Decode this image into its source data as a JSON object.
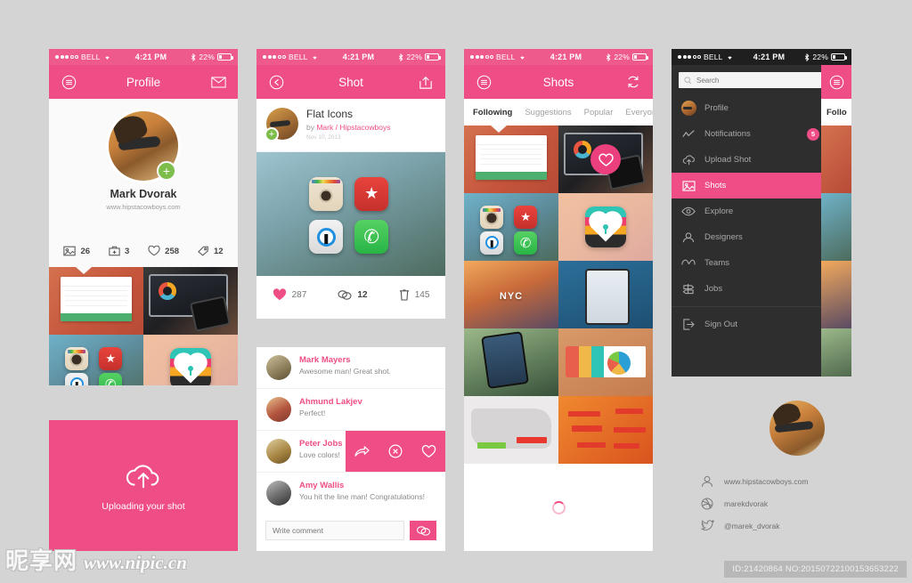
{
  "status_bar": {
    "carrier": "BELL",
    "time": "4:21 PM",
    "battery": "22%"
  },
  "screen_profile": {
    "nav": {
      "menu_icon": "hamburger-circle-icon",
      "title": "Profile",
      "right_icon": "mail-icon"
    },
    "user": {
      "name": "Mark Dvorak",
      "url": "www.hipstacowboys.com",
      "add_label": "+"
    },
    "stats": [
      {
        "icon": "image-icon",
        "value": "26"
      },
      {
        "icon": "bucket-icon",
        "value": "3"
      },
      {
        "icon": "heart-icon",
        "value": "258"
      },
      {
        "icon": "tag-icon",
        "value": "12"
      }
    ],
    "thumbnails": [
      "invoice-app-shot",
      "desk-dashboard-shot",
      "flat-app-icons-shot",
      "lock-heart-icon-shot"
    ]
  },
  "upload_card": {
    "icon": "cloud-upload-icon",
    "caption": "Uploading your shot"
  },
  "screen_shot": {
    "nav": {
      "back_icon": "back-arrow-circle-icon",
      "title": "Shot",
      "right_icon": "share-icon"
    },
    "post": {
      "title": "Flat Icons",
      "byline_prefix": "by ",
      "author": "Mark / Hipstacowboys",
      "date": "Nov 10, 2013",
      "add_label": "+"
    },
    "stats": [
      {
        "icon": "heart-filled-icon",
        "value": "287"
      },
      {
        "icon": "comment-icon",
        "value": "12"
      },
      {
        "icon": "bucket-outline-icon",
        "value": "145"
      }
    ],
    "comments": [
      {
        "name": "Mark Mayers",
        "text": "Awesome man! Great shot.",
        "swiped": false
      },
      {
        "name": "Ahmund Lakjev",
        "text": "Perfect!",
        "swiped": false
      },
      {
        "name": "Peter Jobs",
        "text": "Love colors!",
        "swiped": true
      },
      {
        "name": "Amy Wallis",
        "text": "You hit the line man! Congratulations!",
        "swiped": false
      }
    ],
    "swipe_actions": [
      "share-arrow-icon",
      "delete-circle-icon",
      "heart-outline-icon"
    ],
    "composer": {
      "placeholder": "Write comment",
      "send_icon": "comment-send-icon"
    }
  },
  "screen_shots": {
    "nav": {
      "menu_icon": "hamburger-circle-icon",
      "title": "Shots",
      "right_icon": "refresh-icon"
    },
    "tabs": [
      {
        "label": "Following",
        "active": true
      },
      {
        "label": "Suggestions",
        "active": false
      },
      {
        "label": "Popular",
        "active": false
      },
      {
        "label": "Everyone",
        "active": false
      }
    ],
    "grid": [
      "invoice-app-shot",
      "desk-dashboard-liked-shot",
      "flat-app-icons-shot",
      "lock-heart-icon-shot",
      "nyc-photo-shot",
      "mobile-ui-shot",
      "hand-phone-shot",
      "chart-dashboard-shot",
      "world-map-light-shot",
      "world-map-orange-shot"
    ],
    "loading_icon": "spinner-icon"
  },
  "screen_menu": {
    "search": {
      "placeholder": "Search",
      "icon": "search-icon"
    },
    "items": [
      {
        "label": "Profile",
        "icon": "avatar-icon",
        "active": false,
        "badge": ""
      },
      {
        "label": "Notifications",
        "icon": "activity-line-icon",
        "active": false,
        "badge": "5"
      },
      {
        "label": "Upload Shot",
        "icon": "cloud-upload-icon",
        "active": false,
        "badge": ""
      },
      {
        "label": "Shots",
        "icon": "image-icon",
        "active": true,
        "badge": ""
      },
      {
        "label": "Explore",
        "icon": "eye-icon",
        "active": false,
        "badge": ""
      },
      {
        "label": "Designers",
        "icon": "person-icon",
        "active": false,
        "badge": ""
      },
      {
        "label": "Teams",
        "icon": "teams-icon",
        "active": false,
        "badge": ""
      },
      {
        "label": "Jobs",
        "icon": "signpost-icon",
        "active": false,
        "badge": ""
      }
    ],
    "sign_out": {
      "label": "Sign Out",
      "icon": "sign-out-icon"
    },
    "peek_tab_label": "Follo"
  },
  "identity": {
    "rows": [
      {
        "icon": "person-icon",
        "text": "www.hipstacowboys.com"
      },
      {
        "icon": "dribbble-icon",
        "text": "marekdvorak"
      },
      {
        "icon": "twitter-icon",
        "text": "@marek_dvorak"
      }
    ]
  },
  "watermark": {
    "cn": "昵享网",
    "en": "www.nipic.cn"
  },
  "id_badge": "ID:21420864 NO:20150722100153653222",
  "colors": {
    "accent": "#ef4d86",
    "accent_dark": "#ec3f7e",
    "menu_bg": "#2e2e2e",
    "page_bg": "#d4d4d4",
    "green": "#7dbd4c"
  }
}
